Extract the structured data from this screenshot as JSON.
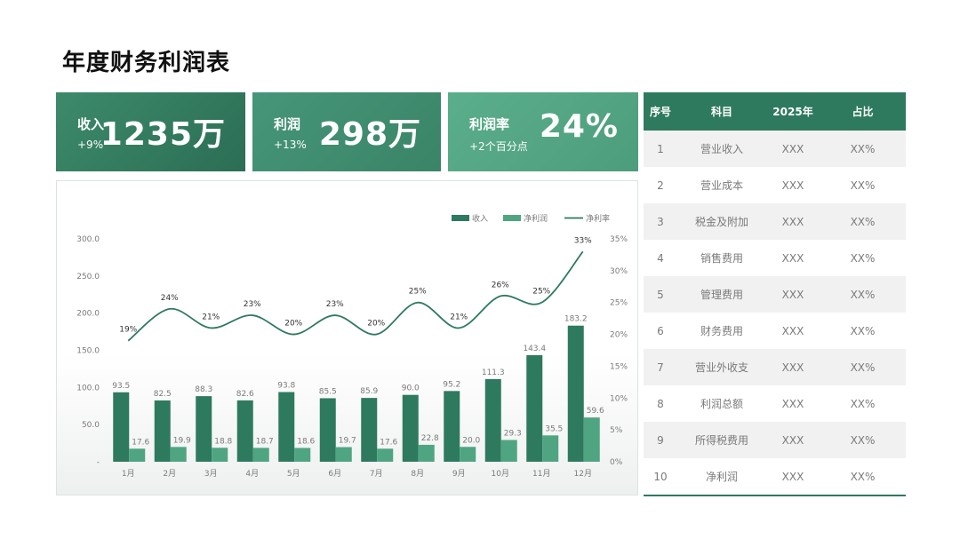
{
  "page": {
    "title": "年度财务利润表"
  },
  "kpis": [
    {
      "label": "收入",
      "change": "+9%",
      "value": "1235万"
    },
    {
      "label": "利润",
      "change": "+13%",
      "value": "298万"
    },
    {
      "label": "利润率",
      "change": "+2个百分点",
      "value": "24%"
    }
  ],
  "colors": {
    "bar_income": "#2e7a5e",
    "bar_profit": "#4fa582",
    "line": "#2e7a5e",
    "header": "#2e7a5e"
  },
  "chart_data": {
    "type": "bar",
    "categories": [
      "1月",
      "2月",
      "3月",
      "4月",
      "5月",
      "6月",
      "7月",
      "8月",
      "9月",
      "10月",
      "11月",
      "12月"
    ],
    "series": [
      {
        "name": "收入",
        "type": "bar",
        "values": [
          93.5,
          82.5,
          88.3,
          82.6,
          93.8,
          85.5,
          85.9,
          90.0,
          95.2,
          111.3,
          143.4,
          183.2
        ],
        "labels": [
          "93.5",
          "82.5",
          "88.3",
          "82.6",
          "93.8",
          "85.5",
          "85.9",
          "90.0",
          "95.2",
          "111.3",
          "143.4",
          "183.2"
        ]
      },
      {
        "name": "净利润",
        "type": "bar",
        "values": [
          17.6,
          19.9,
          18.8,
          18.7,
          18.6,
          19.7,
          17.6,
          22.8,
          20.0,
          29.3,
          35.5,
          59.6
        ],
        "labels": [
          "17.6",
          "19.9",
          "18.8",
          "18.7",
          "18.6",
          "19.7",
          "17.6",
          "22.8",
          "20.0",
          "29.3",
          "35.5",
          "59.6"
        ]
      },
      {
        "name": "净利率",
        "type": "line",
        "axis": "right",
        "values": [
          19,
          24,
          21,
          23,
          20,
          23,
          20,
          25,
          21,
          26,
          25,
          33
        ],
        "labels": [
          "19%",
          "24%",
          "21%",
          "23%",
          "20%",
          "23%",
          "20%",
          "25%",
          "21%",
          "26%",
          "25%",
          "33%"
        ]
      }
    ],
    "y_left": {
      "range": [
        0,
        300
      ],
      "ticks": [
        "-",
        "50.0",
        "100.0",
        "150.0",
        "200.0",
        "250.0",
        "300.0"
      ]
    },
    "y_right": {
      "range": [
        0,
        35
      ],
      "ticks": [
        "0%",
        "5%",
        "10%",
        "15%",
        "20%",
        "25%",
        "30%",
        "35%"
      ]
    },
    "legend_position": "top-right",
    "grid": false
  },
  "table": {
    "headers": [
      "序号",
      "科目",
      "2025年",
      "占比"
    ],
    "rows": [
      [
        "1",
        "营业收入",
        "XXX",
        "XX%"
      ],
      [
        "2",
        "营业成本",
        "XXX",
        "XX%"
      ],
      [
        "3",
        "税金及附加",
        "XXX",
        "XX%"
      ],
      [
        "4",
        "销售费用",
        "XXX",
        "XX%"
      ],
      [
        "5",
        "管理费用",
        "XXX",
        "XX%"
      ],
      [
        "6",
        "财务费用",
        "XXX",
        "XX%"
      ],
      [
        "7",
        "营业外收支",
        "XXX",
        "XX%"
      ],
      [
        "8",
        "利润总额",
        "XXX",
        "XX%"
      ],
      [
        "9",
        "所得税费用",
        "XXX",
        "XX%"
      ],
      [
        "10",
        "净利润",
        "XXX",
        "XX%"
      ]
    ]
  }
}
